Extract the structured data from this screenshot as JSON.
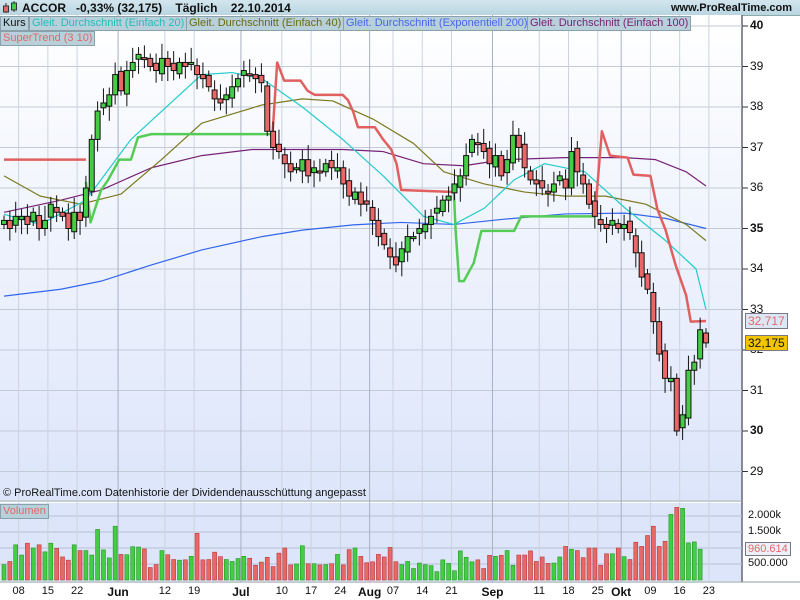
{
  "header": {
    "symbol": "ACCOR",
    "change": "-0,33% (32,175)",
    "period": "Täglich",
    "date": "22.10.2014",
    "site": "www.ProRealTime.com"
  },
  "legend": {
    "kurs": "Kurs",
    "sma20": "Gleit. Durchschnitt (Einfach 20)",
    "sma40": "Gleit. Durchschnitt (Einfach 40)",
    "ema200": "Gleit. Durchschnitt (Exponentiell 200)",
    "sma100": "Gleit. Durchschnitt (Einfach 100)",
    "supertrend": "SuperTrend (3 10)",
    "volume": "Volumen"
  },
  "footer": "© ProRealTime.com  Datenhistorie der Dividendenausschüttung angepasst",
  "colors": {
    "up": "#44cc44",
    "down": "#e86868",
    "sma20": "#22cccc",
    "sma40": "#7a7a20",
    "ema200": "#3366ee",
    "sma100": "#772277",
    "st_up": "#55cc55",
    "st_down": "#e06060"
  },
  "chart_data": {
    "type": "candlestick",
    "price_ticks": [
      "40",
      "39",
      "38",
      "37",
      "36",
      "35",
      "34",
      "33",
      "32",
      "31",
      "30",
      "29"
    ],
    "price_range": [
      28.5,
      40.3
    ],
    "last_price": "32,175",
    "supertrend_value": "32,717",
    "volume_ticks": [
      "2.000k",
      "1.500k",
      "500.000"
    ],
    "volume_last": "960.614",
    "date_ticks": [
      {
        "label": "08",
        "day": 3,
        "month": false
      },
      {
        "label": "15",
        "day": 8,
        "month": false
      },
      {
        "label": "22",
        "day": 13,
        "month": false
      },
      {
        "label": "Jun",
        "day": 20,
        "month": true
      },
      {
        "label": "12",
        "day": 28,
        "month": false
      },
      {
        "label": "19",
        "day": 33,
        "month": false
      },
      {
        "label": "Jul",
        "day": 41,
        "month": true
      },
      {
        "label": "10",
        "day": 48,
        "month": false
      },
      {
        "label": "17",
        "day": 53,
        "month": false
      },
      {
        "label": "24",
        "day": 58,
        "month": false
      },
      {
        "label": "Aug",
        "day": 63,
        "month": true
      },
      {
        "label": "07",
        "day": 67,
        "month": false
      },
      {
        "label": "14",
        "day": 72,
        "month": false
      },
      {
        "label": "21",
        "day": 77,
        "month": false
      },
      {
        "label": "Sep",
        "day": 84,
        "month": true
      },
      {
        "label": "11",
        "day": 92,
        "month": false
      },
      {
        "label": "18",
        "day": 97,
        "month": false
      },
      {
        "label": "25",
        "day": 102,
        "month": false
      },
      {
        "label": "Okt",
        "day": 106,
        "month": true
      },
      {
        "label": "09",
        "day": 111,
        "month": false
      },
      {
        "label": "16",
        "day": 116,
        "month": false
      },
      {
        "label": "23",
        "day": 121,
        "month": false
      }
    ],
    "close": [
      35.2,
      35.0,
      35.3,
      35.3,
      35.1,
      35.4,
      35.0,
      35.2,
      35.6,
      35.4,
      35.3,
      35.0,
      35.4,
      35.2,
      36.0,
      37.2,
      37.9,
      38.1,
      38.3,
      38.8,
      38.4,
      38.9,
      39.1,
      39.3,
      39.2,
      39.0,
      38.9,
      39.2,
      39.0,
      38.9,
      39.1,
      39.0,
      39.1,
      38.8,
      38.7,
      38.5,
      38.2,
      38.1,
      38.3,
      38.5,
      38.7,
      38.9,
      38.8,
      38.7,
      38.6,
      37.4,
      37.0,
      36.9,
      36.6,
      36.4,
      36.5,
      36.7,
      36.3,
      36.5,
      36.4,
      36.6,
      36.5,
      36.5,
      36.1,
      35.8,
      35.9,
      35.6,
      35.6,
      35.2,
      34.8,
      34.6,
      34.3,
      34.1,
      34.5,
      34.8,
      34.8,
      35.0,
      35.1,
      35.3,
      35.5,
      35.7,
      35.8,
      36.1,
      36.3,
      36.8,
      37.2,
      37.1,
      36.9,
      36.6,
      36.8,
      36.3,
      36.7,
      37.3,
      37.0,
      36.5,
      36.2,
      36.1,
      36.0,
      35.9,
      36.1,
      36.3,
      36.0,
      36.9,
      36.4,
      36.1,
      35.6,
      35.3,
      35.1,
      35.0,
      35.2,
      35.0,
      35.1,
      34.9,
      34.4,
      33.8,
      33.5,
      32.7,
      31.9,
      31.3,
      31.3,
      30.0,
      30.4,
      31.5,
      31.7,
      32.5,
      32.175
    ],
    "volume_k": [
      480,
      580,
      1100,
      780,
      1150,
      1000,
      1100,
      880,
      1150,
      990,
      720,
      620,
      1100,
      920,
      920,
      780,
      1580,
      940,
      690,
      1680,
      800,
      790,
      1040,
      1030,
      970,
      390,
      480,
      920,
      790,
      640,
      620,
      630,
      740,
      1460,
      630,
      640,
      870,
      730,
      640,
      580,
      670,
      740,
      680,
      460,
      560,
      710,
      420,
      840,
      1000,
      470,
      500,
      1070,
      510,
      510,
      470,
      480,
      510,
      800,
      470,
      950,
      1000,
      740,
      540,
      570,
      800,
      720,
      1020,
      570,
      480,
      580,
      360,
      530,
      480,
      450,
      260,
      630,
      520,
      290,
      910,
      710,
      570,
      630,
      360,
      770,
      740,
      770,
      920,
      460,
      780,
      780,
      910,
      580,
      720,
      520,
      530,
      720,
      1050,
      960,
      920,
      700,
      1000,
      1000,
      460,
      820,
      820,
      1000,
      730,
      640,
      1180,
      1050,
      1390,
      1680,
      1050,
      1210,
      2050,
      2270,
      2240,
      1160,
      1190,
      960.614
    ],
    "sma20": [
      [
        0,
        35.35
      ],
      [
        6.2,
        35.1
      ],
      [
        14,
        35.7
      ],
      [
        21.7,
        37.2
      ],
      [
        33.8,
        38.8
      ],
      [
        39,
        38.85
      ],
      [
        44.1,
        38.7
      ],
      [
        51,
        38.0
      ],
      [
        57.9,
        37.2
      ],
      [
        64.8,
        36.3
      ],
      [
        71.7,
        35.3
      ],
      [
        76.9,
        35.1
      ],
      [
        82.1,
        35.5
      ],
      [
        87.2,
        36.2
      ],
      [
        92.4,
        36.6
      ],
      [
        99.3,
        36.4
      ],
      [
        106.2,
        35.5
      ],
      [
        113.1,
        34.7
      ],
      [
        118.3,
        34.0
      ],
      [
        120,
        33.0
      ]
    ],
    "sma40": [
      [
        0,
        36.3
      ],
      [
        6.2,
        35.8
      ],
      [
        13.1,
        35.6
      ],
      [
        20,
        35.85
      ],
      [
        26.9,
        36.7
      ],
      [
        33.8,
        37.6
      ],
      [
        44.1,
        38.05
      ],
      [
        51,
        38.2
      ],
      [
        56.2,
        38.15
      ],
      [
        63.1,
        37.7
      ],
      [
        70,
        37.1
      ],
      [
        75.2,
        36.4
      ],
      [
        82.1,
        36.1
      ],
      [
        89,
        35.9
      ],
      [
        95.9,
        35.8
      ],
      [
        102.8,
        35.8
      ],
      [
        109.7,
        35.6
      ],
      [
        116.6,
        35.1
      ],
      [
        120,
        34.7
      ]
    ],
    "sma100": [
      [
        0,
        35.4
      ],
      [
        9.7,
        35.7
      ],
      [
        16.6,
        35.95
      ],
      [
        25.2,
        36.5
      ],
      [
        33.8,
        36.8
      ],
      [
        42.4,
        36.95
      ],
      [
        51,
        36.95
      ],
      [
        57.9,
        36.95
      ],
      [
        64.8,
        36.9
      ],
      [
        71.7,
        36.6
      ],
      [
        78.6,
        36.55
      ],
      [
        85.5,
        36.7
      ],
      [
        95.9,
        36.75
      ],
      [
        106.2,
        36.75
      ],
      [
        111.4,
        36.7
      ],
      [
        116.6,
        36.4
      ],
      [
        120,
        36.05
      ]
    ],
    "ema200": [
      [
        0,
        33.33
      ],
      [
        9.7,
        33.5
      ],
      [
        16.6,
        33.7
      ],
      [
        25.2,
        34.1
      ],
      [
        33.8,
        34.47
      ],
      [
        44.1,
        34.8
      ],
      [
        51,
        34.96
      ],
      [
        59.7,
        35.09
      ],
      [
        67.9,
        35.15
      ],
      [
        76.9,
        35.1
      ],
      [
        85.5,
        35.23
      ],
      [
        95.9,
        35.36
      ],
      [
        106.2,
        35.38
      ],
      [
        113.1,
        35.25
      ],
      [
        120,
        35.0
      ]
    ],
    "supertrend": [
      {
        "trend": "down",
        "points": [
          [
            0,
            36.7
          ],
          [
            14,
            36.7
          ]
        ]
      },
      {
        "trend": "up",
        "points": [
          [
            14,
            36.15
          ],
          [
            14.8,
            35.15
          ],
          [
            16.6,
            35.95
          ],
          [
            17.8,
            36.2
          ],
          [
            19.7,
            36.7
          ],
          [
            21.7,
            36.7
          ],
          [
            22.9,
            37.25
          ],
          [
            25.2,
            37.33
          ],
          [
            45.9,
            37.33
          ]
        ]
      },
      {
        "trend": "down",
        "points": [
          [
            45.9,
            37.33
          ],
          [
            46.7,
            39.1
          ],
          [
            47.9,
            38.65
          ],
          [
            50.7,
            38.65
          ],
          [
            51.9,
            38.4
          ],
          [
            53.1,
            38.3
          ],
          [
            57.9,
            38.3
          ],
          [
            58.8,
            38.17
          ],
          [
            59.7,
            37.88
          ],
          [
            60.5,
            37.5
          ],
          [
            63.4,
            37.5
          ],
          [
            64.8,
            37.2
          ],
          [
            66.2,
            36.95
          ],
          [
            67.1,
            36.6
          ],
          [
            67.9,
            35.95
          ],
          [
            76.9,
            35.9
          ]
        ]
      },
      {
        "trend": "up",
        "points": [
          [
            76.9,
            35.9
          ],
          [
            77.2,
            34.96
          ],
          [
            77.8,
            33.7
          ],
          [
            78.6,
            33.7
          ],
          [
            80.3,
            34.15
          ],
          [
            81.6,
            34.94
          ],
          [
            87.2,
            34.94
          ],
          [
            88.4,
            35.3
          ],
          [
            101,
            35.3
          ]
        ]
      },
      {
        "trend": "down",
        "points": [
          [
            101,
            35.3
          ],
          [
            102.2,
            37.4
          ],
          [
            103.6,
            36.8
          ],
          [
            106.6,
            36.75
          ],
          [
            107.6,
            36.33
          ],
          [
            110.5,
            36.3
          ],
          [
            111.7,
            35.47
          ],
          [
            113.1,
            34.96
          ],
          [
            114.8,
            34.1
          ],
          [
            116.6,
            33.35
          ],
          [
            117.4,
            32.7
          ],
          [
            120,
            32.717
          ]
        ]
      }
    ]
  }
}
